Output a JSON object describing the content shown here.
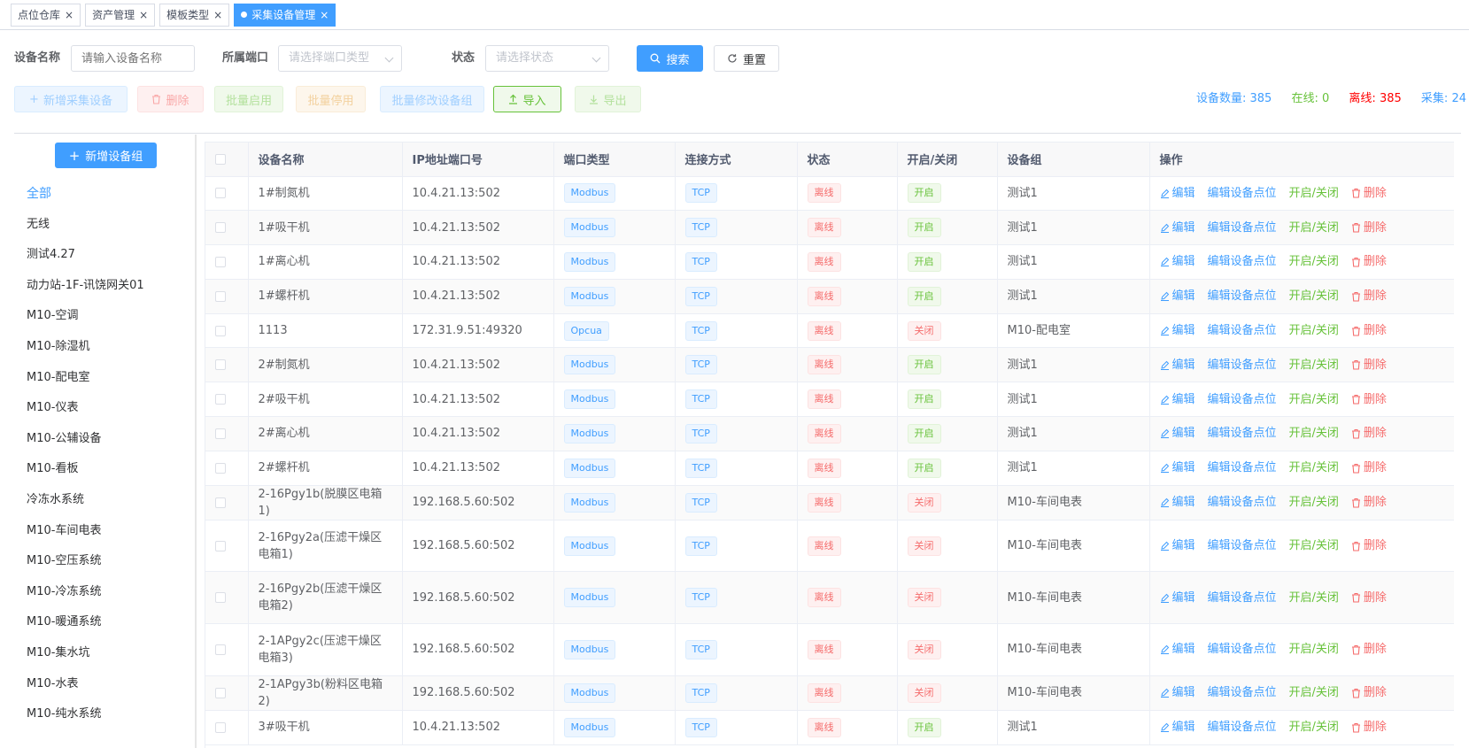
{
  "tabs": [
    {
      "label": "点位仓库",
      "active": false
    },
    {
      "label": "资产管理",
      "active": false
    },
    {
      "label": "模板类型",
      "active": false
    },
    {
      "label": "采集设备管理",
      "active": true
    }
  ],
  "search": {
    "device_name_label": "设备名称",
    "device_name_placeholder": "请输入设备名称",
    "port_label": "所属端口",
    "port_placeholder": "请选择端口类型",
    "status_label": "状态",
    "status_placeholder": "请选择状态",
    "search_button": "搜索",
    "reset_button": "重置"
  },
  "toolbar": {
    "add_device": "新增采集设备",
    "delete": "删除",
    "batch_enable": "批量启用",
    "batch_disable": "批量停用",
    "batch_edit_group": "批量修改设备组",
    "import": "导入",
    "export": "导出"
  },
  "stats": {
    "count_label": "设备数量:",
    "count": "385",
    "online_label": "在线:",
    "online": "0",
    "offline_label": "离线:",
    "offline": "385",
    "collect_label": "采集:",
    "collect": "24"
  },
  "sidebar": {
    "add_group_button": "新增设备组",
    "items": [
      "全部",
      "无线",
      "测试4.27",
      "动力站-1F-讯饶网关01",
      "M10-空调",
      "M10-除湿机",
      "M10-配电室",
      "M10-仪表",
      "M10-公辅设备",
      "M10-看板",
      "冷冻水系统",
      "M10-车间电表",
      "M10-空压系统",
      "M10-冷冻系统",
      "M10-暖通系统",
      "M10-集水坑",
      "M10-水表",
      "M10-纯水系统"
    ]
  },
  "table": {
    "headers": [
      "设备名称",
      "IP地址端口号",
      "端口类型",
      "连接方式",
      "状态",
      "开启/关闭",
      "设备组",
      "操作"
    ],
    "ops": {
      "edit": "编辑",
      "edit_points": "编辑设备点位",
      "toggle": "开启/关闭",
      "delete": "删除"
    },
    "rows": [
      {
        "name": "1#制氮机",
        "ip": "10.4.21.13:502",
        "port": "Modbus",
        "conn": "TCP",
        "status": "离线",
        "switch": "开启",
        "group": "测试1"
      },
      {
        "name": "1#吸干机",
        "ip": "10.4.21.13:502",
        "port": "Modbus",
        "conn": "TCP",
        "status": "离线",
        "switch": "开启",
        "group": "测试1"
      },
      {
        "name": "1#离心机",
        "ip": "10.4.21.13:502",
        "port": "Modbus",
        "conn": "TCP",
        "status": "离线",
        "switch": "开启",
        "group": "测试1"
      },
      {
        "name": "1#螺杆机",
        "ip": "10.4.21.13:502",
        "port": "Modbus",
        "conn": "TCP",
        "status": "离线",
        "switch": "开启",
        "group": "测试1"
      },
      {
        "name": "1113",
        "ip": "172.31.9.51:49320",
        "port": "Opcua",
        "conn": "TCP",
        "status": "离线",
        "switch": "关闭",
        "group": "M10-配电室"
      },
      {
        "name": "2#制氮机",
        "ip": "10.4.21.13:502",
        "port": "Modbus",
        "conn": "TCP",
        "status": "离线",
        "switch": "开启",
        "group": "测试1"
      },
      {
        "name": "2#吸干机",
        "ip": "10.4.21.13:502",
        "port": "Modbus",
        "conn": "TCP",
        "status": "离线",
        "switch": "开启",
        "group": "测试1"
      },
      {
        "name": "2#离心机",
        "ip": "10.4.21.13:502",
        "port": "Modbus",
        "conn": "TCP",
        "status": "离线",
        "switch": "开启",
        "group": "测试1"
      },
      {
        "name": "2#螺杆机",
        "ip": "10.4.21.13:502",
        "port": "Modbus",
        "conn": "TCP",
        "status": "离线",
        "switch": "开启",
        "group": "测试1"
      },
      {
        "name": "2-16Pgy1b(脱膜区电箱1)",
        "ip": "192.168.5.60:502",
        "port": "Modbus",
        "conn": "TCP",
        "status": "离线",
        "switch": "关闭",
        "group": "M10-车间电表"
      },
      {
        "name": "2-16Pgy2a(压滤干燥区电箱1)",
        "ip": "192.168.5.60:502",
        "port": "Modbus",
        "conn": "TCP",
        "status": "离线",
        "switch": "关闭",
        "group": "M10-车间电表",
        "tall": true
      },
      {
        "name": "2-16Pgy2b(压滤干燥区电箱2)",
        "ip": "192.168.5.60:502",
        "port": "Modbus",
        "conn": "TCP",
        "status": "离线",
        "switch": "关闭",
        "group": "M10-车间电表",
        "tall": true
      },
      {
        "name": "2-1APgy2c(压滤干燥区电箱3)",
        "ip": "192.168.5.60:502",
        "port": "Modbus",
        "conn": "TCP",
        "status": "离线",
        "switch": "关闭",
        "group": "M10-车间电表",
        "tall": true
      },
      {
        "name": "2-1APgy3b(粉料区电箱2)",
        "ip": "192.168.5.60:502",
        "port": "Modbus",
        "conn": "TCP",
        "status": "离线",
        "switch": "关闭",
        "group": "M10-车间电表"
      },
      {
        "name": "3#吸干机",
        "ip": "10.4.21.13:502",
        "port": "Modbus",
        "conn": "TCP",
        "status": "离线",
        "switch": "开启",
        "group": "测试1"
      }
    ]
  },
  "colors": {
    "primary": "#409eff",
    "success": "#67c23a",
    "danger": "#f56c6c",
    "warning": "#e6a23c"
  }
}
